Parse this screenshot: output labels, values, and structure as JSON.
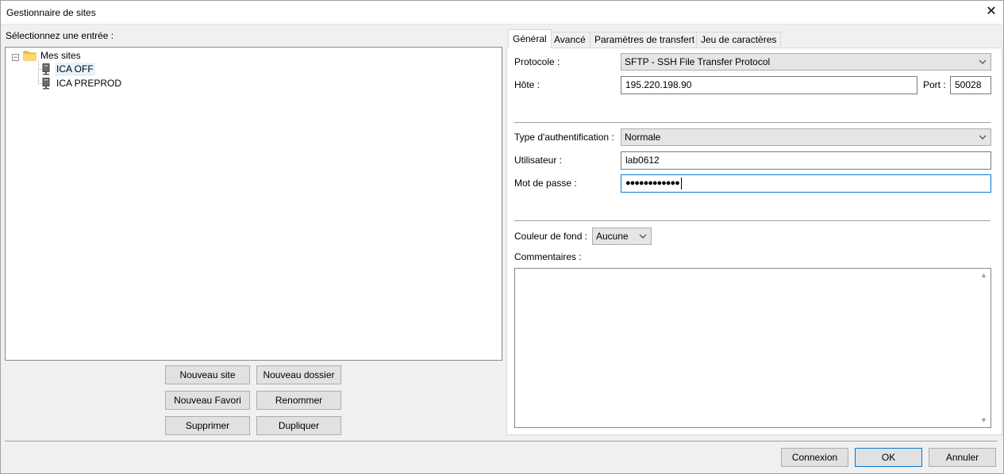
{
  "window": {
    "title": "Gestionnaire de sites",
    "close_glyph": "✕"
  },
  "left": {
    "select_label": "Sélectionnez une entrée :",
    "tree": {
      "root": {
        "label": "Mes sites",
        "expander": "−"
      },
      "children": [
        {
          "label": "ICA OFF",
          "selected": true
        },
        {
          "label": "ICA PREPROD",
          "selected": false
        }
      ]
    },
    "buttons": {
      "new_site": "Nouveau site",
      "new_folder": "Nouveau dossier",
      "new_bookmark": "Nouveau Favori",
      "rename": "Renommer",
      "delete": "Supprimer",
      "duplicate": "Dupliquer"
    }
  },
  "tabs": [
    {
      "label": "Général",
      "active": true
    },
    {
      "label": "Avancé",
      "active": false
    },
    {
      "label": "Paramètres de transfert",
      "active": false
    },
    {
      "label": "Jeu de caractères",
      "active": false
    }
  ],
  "general": {
    "protocol_label": "Protocole :",
    "protocol_value": "SFTP - SSH File Transfer Protocol",
    "host_label": "Hôte :",
    "host_value": "195.220.198.90",
    "port_label": "Port :",
    "port_value": "50028",
    "auth_type_label": "Type d'authentification :",
    "auth_type_value": "Normale",
    "user_label": "Utilisateur :",
    "user_value": "lab0612",
    "password_label": "Mot de passe :",
    "password_value": "●●●●●●●●●●●●",
    "bg_color_label": "Couleur de fond :",
    "bg_color_value": "Aucune",
    "comments_label": "Commentaires :"
  },
  "footer": {
    "connect": "Connexion",
    "ok": "OK",
    "cancel": "Annuler"
  },
  "icons": {
    "close": "close-icon",
    "folder": "folder-icon",
    "server": "server-icon",
    "dropdown": "chevron-down-icon"
  },
  "colors": {
    "folder": "#f5c242",
    "selection": "#e5f3ff",
    "focus_border": "#0078d7",
    "window_bg": "#f0f0f0"
  }
}
